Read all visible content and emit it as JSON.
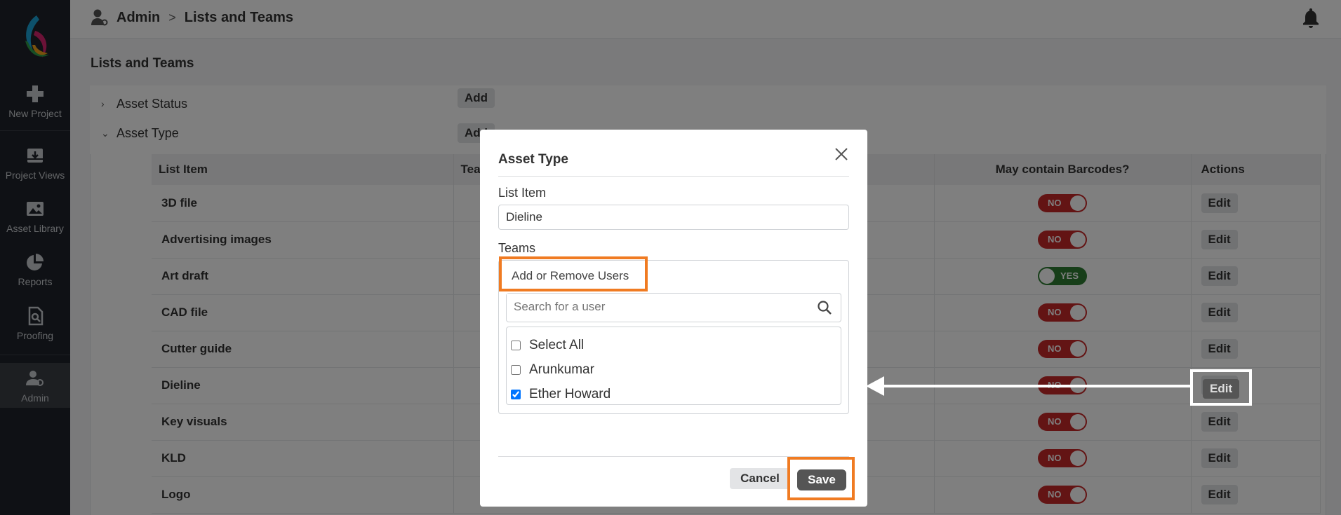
{
  "sidebar": {
    "items": [
      {
        "label": "New Project",
        "icon": "plus-icon"
      },
      {
        "label": "Project Views",
        "icon": "download-box-icon"
      },
      {
        "label": "Asset Library",
        "icon": "image-icon"
      },
      {
        "label": "Reports",
        "icon": "pie-chart-icon"
      },
      {
        "label": "Proofing",
        "icon": "proof-search-icon"
      },
      {
        "label": "Admin",
        "icon": "admin-user-icon"
      }
    ]
  },
  "header": {
    "crumb_root": "Admin",
    "crumb_sep": ">",
    "crumb_current": "Lists and Teams"
  },
  "main": {
    "page_title": "Lists and Teams",
    "sections": [
      {
        "label": "Asset Status",
        "add_label": "Add",
        "chevron": "›"
      },
      {
        "label": "Asset Type",
        "add_label": "Add",
        "chevron": "⌄"
      }
    ],
    "table": {
      "headers": [
        "List Item",
        "Tea",
        "May contain Barcodes?",
        "Actions"
      ],
      "rows": [
        {
          "item": "3D file",
          "barcode": "NO"
        },
        {
          "item": "Advertising images",
          "barcode": "NO"
        },
        {
          "item": "Art draft",
          "barcode": "YES"
        },
        {
          "item": "CAD file",
          "barcode": "NO"
        },
        {
          "item": "Cutter guide",
          "barcode": "NO"
        },
        {
          "item": "Dieline",
          "barcode": "NO"
        },
        {
          "item": "Key visuals",
          "barcode": "NO"
        },
        {
          "item": "KLD",
          "barcode": "NO"
        },
        {
          "item": "Logo",
          "barcode": "NO"
        }
      ],
      "edit_label": "Edit"
    }
  },
  "modal": {
    "title": "Asset Type",
    "list_item_label": "List Item",
    "list_item_value": "Dieline",
    "teams_label": "Teams",
    "add_remove_label": "Add or Remove Users",
    "search_placeholder": "Search for a user",
    "users": [
      {
        "name": "Select All",
        "checked": false
      },
      {
        "name": "Arunkumar",
        "checked": false
      },
      {
        "name": "Ether Howard",
        "checked": true
      }
    ],
    "cancel_label": "Cancel",
    "save_label": "Save"
  },
  "colors": {
    "sidebar_bg": "#1f232a",
    "highlight": "#f07b22",
    "toggle_no": "#c62828",
    "toggle_yes": "#2e7d32"
  }
}
